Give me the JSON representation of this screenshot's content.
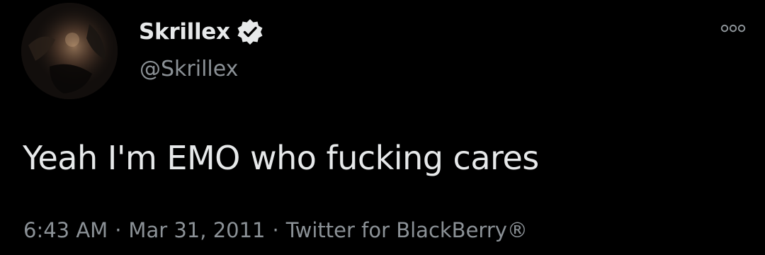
{
  "tweet": {
    "display_name": "Skrillex",
    "handle": "@Skrillex",
    "text": "Yeah I'm EMO who fucking cares",
    "time": "6:43 AM",
    "date": "Mar 31, 2011",
    "separator": "·",
    "source": "Twitter for BlackBerry®",
    "verified": true
  },
  "icons": {
    "avatar": "avatar-photo",
    "verified": "verified-badge-icon",
    "more": "more-options-icon"
  },
  "colors": {
    "background": "#000000",
    "primary_text": "#e7e9ea",
    "secondary_text": "#8b9196"
  }
}
